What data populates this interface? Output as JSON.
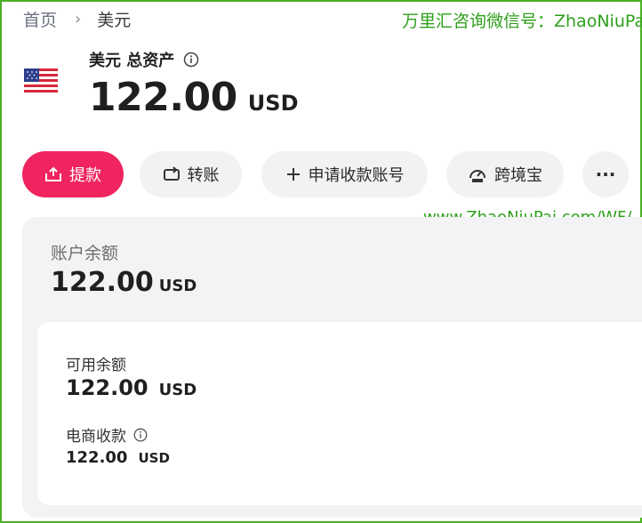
{
  "breadcrumb": {
    "home": "首页",
    "separator": "›",
    "current": "美元"
  },
  "watermarks": {
    "top_right": "万里汇咨询微信号：ZhaoNiuPai",
    "middle": "www.ZhaoNiuPai.com/WF/"
  },
  "account": {
    "flag": "us-flag",
    "title": "美元 总资产",
    "total_amount": "122.00",
    "total_currency": "USD"
  },
  "actions": [
    {
      "label": "提款",
      "icon": "withdraw-icon"
    },
    {
      "label": "转账",
      "icon": "transfer-icon"
    },
    {
      "label": "申请收款账号",
      "icon": "plus-icon"
    },
    {
      "label": "跨境宝",
      "icon": "gauge-icon"
    },
    {
      "label": "···",
      "icon": "more-icon"
    }
  ],
  "balance": {
    "label": "账户余额",
    "amount": "122.00",
    "currency": "USD",
    "available": {
      "label": "可用余额",
      "amount": "122.00",
      "currency": "USD"
    },
    "ecommerce": {
      "label": "电商收款",
      "amount": "122.00",
      "currency": "USD"
    }
  },
  "colors": {
    "primary": "#f0245e",
    "watermark": "#2ea01c",
    "panel": "#f3f3f5"
  }
}
